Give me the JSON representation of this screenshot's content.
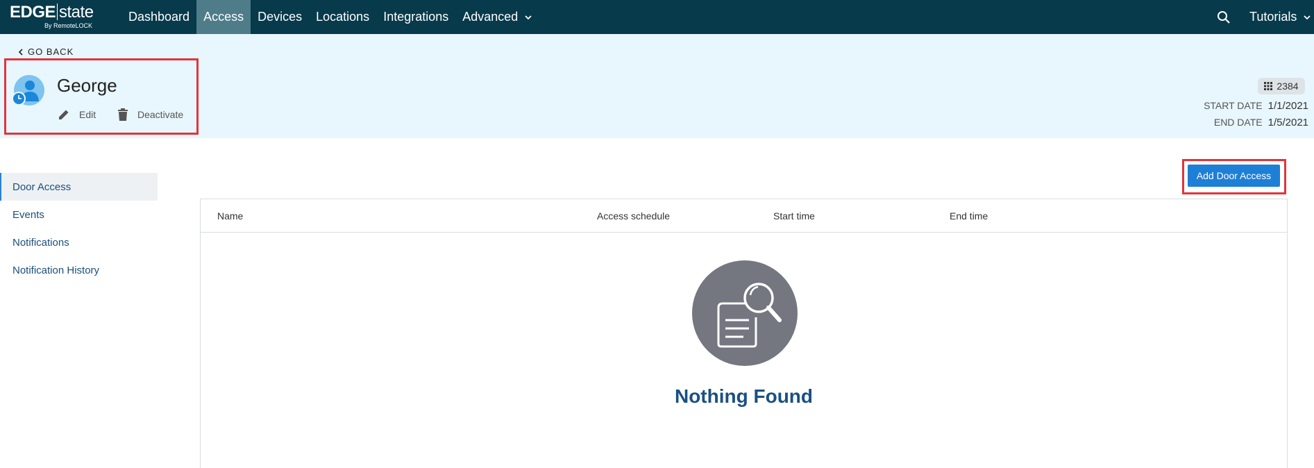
{
  "brand": {
    "name_bold": "EDGE",
    "name_light": "state",
    "byline": "By RemoteLOCK"
  },
  "nav": {
    "items": [
      {
        "label": "Dashboard",
        "active": false
      },
      {
        "label": "Access",
        "active": true
      },
      {
        "label": "Devices",
        "active": false
      },
      {
        "label": "Locations",
        "active": false
      },
      {
        "label": "Integrations",
        "active": false
      },
      {
        "label": "Advanced",
        "active": false
      }
    ],
    "tutorials_label": "Tutorials"
  },
  "header": {
    "go_back_label": "GO BACK",
    "user_name": "George",
    "edit_label": "Edit",
    "deactivate_label": "Deactivate",
    "pin": "2384",
    "start_date_label": "START DATE",
    "start_date": "1/1/2021",
    "end_date_label": "END DATE",
    "end_date": "1/5/2021"
  },
  "sidebar": {
    "items": [
      {
        "label": "Door Access",
        "active": true
      },
      {
        "label": "Events",
        "active": false
      },
      {
        "label": "Notifications",
        "active": false
      },
      {
        "label": "Notification History",
        "active": false
      }
    ]
  },
  "main": {
    "add_button_label": "Add Door Access",
    "columns": [
      "Name",
      "Access schedule",
      "Start time",
      "End time"
    ],
    "rows": [],
    "empty_text": "Nothing Found"
  },
  "colors": {
    "topbar": "#073a4b",
    "active_nav": "#4e7c89",
    "header_band": "#e8f6fd",
    "primary_button": "#1e7fd6",
    "highlight": "#e0353a",
    "empty_heading": "#1a5082"
  }
}
